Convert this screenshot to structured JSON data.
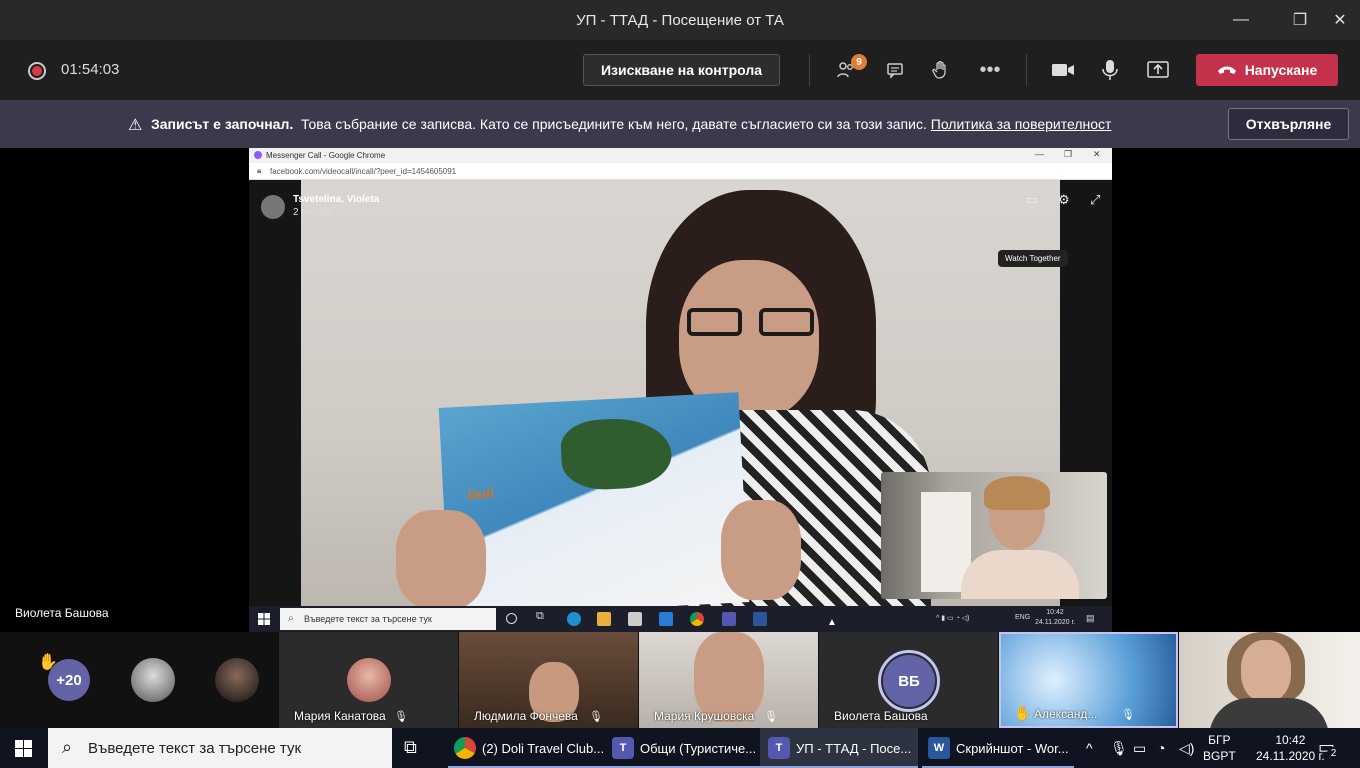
{
  "window": {
    "title": "УП - ТТАД - Посещение от ТА",
    "minimize": "—",
    "restore": "❐",
    "close": "✕"
  },
  "meeting": {
    "timer": "01:54:03",
    "request_control": "Изискване на контрола",
    "participants_badge": "9",
    "leave": "Напускане"
  },
  "banner": {
    "bold_text": "Записът е започнал.",
    "text": "Това събрание се записва. Като се присъедините към него, давате съгласието си за този запис.",
    "link": "Политика за поверителност",
    "dismiss": "Отхвърляне"
  },
  "shared_screen": {
    "browser_title": "Messenger Call - Google Chrome",
    "url": "facebook.com/videocall/incall/?peer_id=1454605091",
    "call_name": "Tsvetelina, Violeta",
    "call_people": "2 people",
    "tooltip": "Watch Together",
    "brochure_logo": "Doli",
    "inner_search": "Въведете текст за търсене тук",
    "inner_lang": "ENG",
    "inner_time": "10:42",
    "inner_date": "24.11.2020 г."
  },
  "speaker_name": "Виолета Башова",
  "participants": {
    "overflow": "+20",
    "tiles": [
      {
        "name": "Мария Канатова"
      },
      {
        "name": "Людмила Фончева"
      },
      {
        "name": "Мария Крушовска"
      },
      {
        "name": "Виолета Башова",
        "initials": "ВБ"
      },
      {
        "name": "Александ..."
      }
    ]
  },
  "taskbar": {
    "search": "Въведете текст за търсене тук",
    "apps": [
      {
        "label": "(2) Doli Travel Club..."
      },
      {
        "label": "Общи (Туристиче..."
      },
      {
        "label": "УП - ТТАД - Посе..."
      },
      {
        "label": "Скрийншот - Wor..."
      }
    ],
    "lang_top": "БГР",
    "lang_bottom": "BGPT",
    "time": "10:42",
    "date": "24.11.2020 г.",
    "notifications": "2"
  },
  "colors": {
    "leave_red": "#c4314b",
    "teams_purple": "#6264a7",
    "banner_bg": "#3b3a4c"
  }
}
